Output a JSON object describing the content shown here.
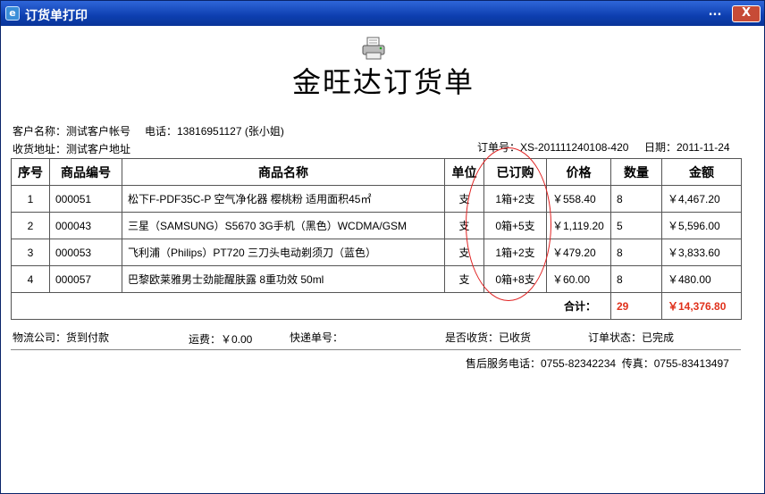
{
  "window": {
    "title": "订货单打印",
    "more_label": "...",
    "close_label": "X"
  },
  "doc": {
    "title": "金旺达订货单"
  },
  "customer": {
    "name_text": "客户名称：测试客户帐号",
    "phone_text": "电话：13816951127 (张小姐)",
    "address_text": "收货地址：测试客户地址"
  },
  "order": {
    "number_text": "订单号：XS-201111240108-420",
    "date_text": "日期：2011-11-24"
  },
  "table": {
    "headers": [
      "序号",
      "商品编号",
      "商品名称",
      "单位",
      "已订购",
      "价格",
      "数量",
      "金额"
    ],
    "rows": [
      {
        "idx": "1",
        "code": "000051",
        "name": "松下F-PDF35C-P 空气净化器 樱桃粉 适用面积45㎡",
        "unit": "支",
        "ordered": "1箱+2支",
        "price": "￥558.40",
        "qty": "8",
        "amount": "￥4,467.20"
      },
      {
        "idx": "2",
        "code": "000043",
        "name": "三星（SAMSUNG）S5670 3G手机（黑色）WCDMA/GSM",
        "unit": "支",
        "ordered": "0箱+5支",
        "price": "￥1,119.20",
        "qty": "5",
        "amount": "￥5,596.00"
      },
      {
        "idx": "3",
        "code": "000053",
        "name": "飞利浦（Philips）PT720 三刀头电动剃须刀（蓝色）",
        "unit": "支",
        "ordered": "1箱+2支",
        "price": "￥479.20",
        "qty": "8",
        "amount": "￥3,833.60"
      },
      {
        "idx": "4",
        "code": "000057",
        "name": "巴黎欧莱雅男士劲能醒肤露 8重功效 50ml",
        "unit": "支",
        "ordered": "0箱+8支",
        "price": "￥60.00",
        "qty": "8",
        "amount": "￥480.00"
      }
    ],
    "total_label": "合计：",
    "total_qty": "29",
    "total_amount": "￥14,376.80"
  },
  "footer": {
    "logistics_text": "物流公司：货到付款",
    "freight_text": "运费：￥0.00",
    "tracking_text": "快递单号：",
    "received_text": "是否收货：已收货",
    "status_text": "订单状态：已完成",
    "service_text": "售后服务电话：0755-82342234  传真：0755-83413497"
  },
  "colors": {
    "titlebar": "#0d3fb0",
    "accent_red": "#e0311b",
    "circle": "#e02020"
  },
  "icons": {
    "app": "app-icon",
    "printer": "printer-icon"
  }
}
